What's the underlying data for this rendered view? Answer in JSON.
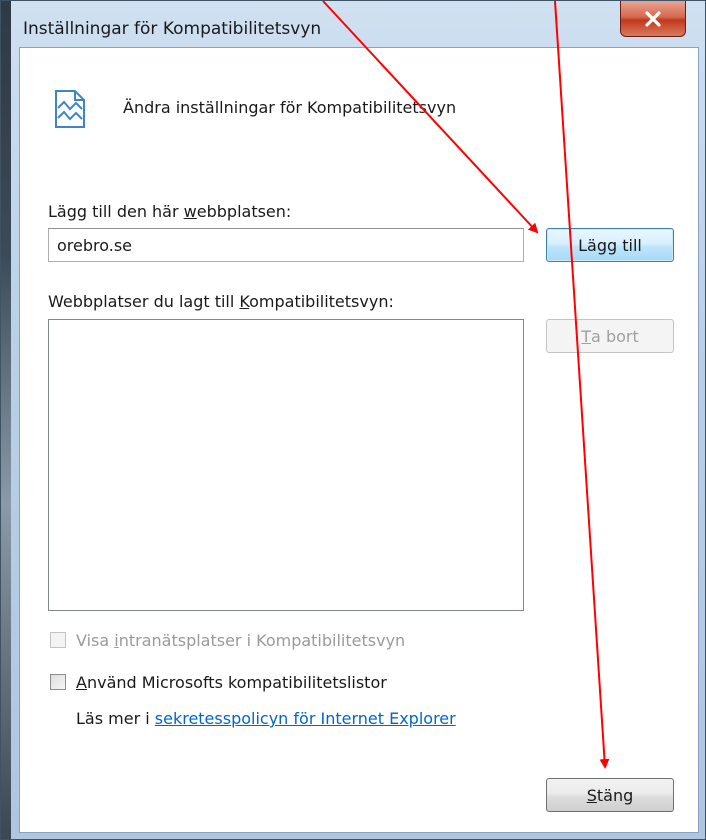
{
  "window": {
    "title": "Inställningar för Kompatibilitetsvyn"
  },
  "header": {
    "icon": "compatibility-view-broken-page-icon",
    "text": "Ändra inställningar för Kompatibilitetsvyn"
  },
  "add_site": {
    "label_before": "Lägg till den här ",
    "label_mnemonic": "w",
    "label_after": "ebbplatsen:",
    "input_value": "orebro.se",
    "button_label": "Lägg till"
  },
  "site_list": {
    "label_before": "Webbplatser du lagt till ",
    "label_mnemonic": "K",
    "label_after": "ompatibilitetsvyn:",
    "items": [],
    "remove_mnemonic": "T",
    "remove_rest": "a bort"
  },
  "options": {
    "intranet": {
      "before": "Visa ",
      "mnemonic": "i",
      "after": "ntranätsplatser i Kompatibilitetsvyn",
      "checked": false,
      "enabled": false
    },
    "microsoft_lists": {
      "mnemonic": "A",
      "after": "nvänd Microsofts kompatibilitetslistor",
      "checked": false,
      "enabled": true
    }
  },
  "privacy": {
    "prefix": "Läs mer i ",
    "link_text": "sekretesspolicyn för Internet Explorer"
  },
  "footer": {
    "close_mnemonic": "S",
    "close_rest": "täng"
  },
  "colors": {
    "annotation_arrow": "#ff0000",
    "link": "#0066cc",
    "close_button_red": "#c1391d"
  }
}
